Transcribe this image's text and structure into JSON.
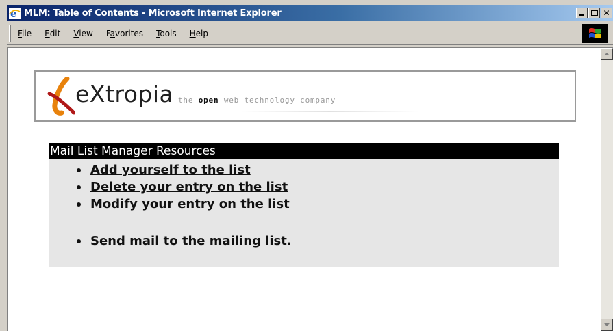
{
  "window": {
    "title": "MLM: Table of Contents - Microsoft Internet Explorer"
  },
  "menu": {
    "items": [
      {
        "label": "File",
        "accel": "F"
      },
      {
        "label": "Edit",
        "accel": "E"
      },
      {
        "label": "View",
        "accel": "V"
      },
      {
        "label": "Favorites",
        "accel": "a"
      },
      {
        "label": "Tools",
        "accel": "T"
      },
      {
        "label": "Help",
        "accel": "H"
      }
    ]
  },
  "logo": {
    "wordmark": "eXtropia",
    "tagline_pre": "the ",
    "tagline_bold": "open",
    "tagline_post": " web technology company"
  },
  "resources": {
    "header": "Mail List Manager Resources",
    "links": [
      "Add yourself to the list",
      "Delete your entry on the list",
      "Modify your entry on the list",
      "Send mail to the mailing list."
    ]
  },
  "icons": {
    "app": "ie-icon",
    "minimize": "minimize-icon",
    "maximize": "maximize-icon",
    "close": "close-icon",
    "throbber": "windows-logo-icon",
    "scroll_up": "scroll-up-arrow-icon",
    "scroll_down": "scroll-down-arrow-icon"
  },
  "colors": {
    "titlebar_start": "#0a246a",
    "titlebar_end": "#a6caf0",
    "resources_header_bg": "#000000",
    "resources_bg": "#e6e6e6",
    "logo_accent_orange": "#e8820c",
    "logo_accent_red": "#b01818"
  }
}
